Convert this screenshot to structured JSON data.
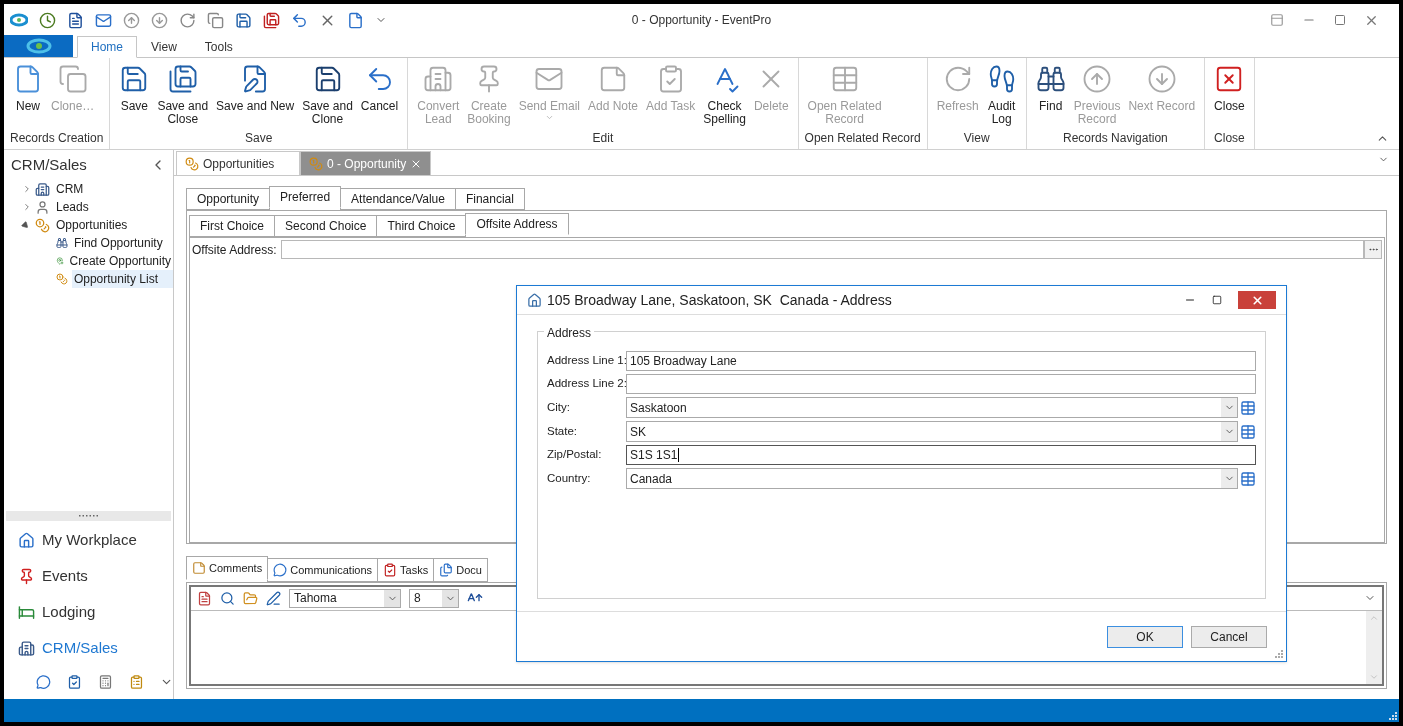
{
  "window": {
    "title": "0 - Opportunity - EventPro"
  },
  "ribbon": {
    "tabs": [
      {
        "label": "Home",
        "selected": true
      },
      {
        "label": "View",
        "selected": false
      },
      {
        "label": "Tools",
        "selected": false
      }
    ],
    "groups": [
      {
        "label": "Records Creation",
        "buttons": [
          {
            "label": "New",
            "disabled": false,
            "dropdown": false
          },
          {
            "label": "Clone…",
            "disabled": true,
            "dropdown": false
          }
        ]
      },
      {
        "label": "Save",
        "buttons": [
          {
            "label": "Save",
            "disabled": false,
            "dropdown": false
          },
          {
            "label": "Save and\nClose",
            "disabled": false,
            "dropdown": false
          },
          {
            "label": "Save and New",
            "disabled": false,
            "dropdown": false
          },
          {
            "label": "Save and\nClone",
            "disabled": false,
            "dropdown": false
          },
          {
            "label": "Cancel",
            "disabled": false,
            "dropdown": false
          }
        ]
      },
      {
        "label": "Edit",
        "buttons": [
          {
            "label": "Convert\nLead",
            "disabled": true,
            "dropdown": false
          },
          {
            "label": "Create\nBooking",
            "disabled": true,
            "dropdown": false
          },
          {
            "label": "Send Email",
            "disabled": true,
            "dropdown": true
          },
          {
            "label": "Add Note",
            "disabled": true,
            "dropdown": false
          },
          {
            "label": "Add Task",
            "disabled": true,
            "dropdown": false
          },
          {
            "label": "Check\nSpelling",
            "disabled": false,
            "dropdown": false
          },
          {
            "label": "Delete",
            "disabled": true,
            "dropdown": false
          }
        ]
      },
      {
        "label": "Open Related Record",
        "buttons": [
          {
            "label": "Open Related\nRecord",
            "disabled": true,
            "dropdown": false
          }
        ]
      },
      {
        "label": "View",
        "buttons": [
          {
            "label": "Refresh",
            "disabled": true,
            "dropdown": false
          },
          {
            "label": "Audit\nLog",
            "disabled": false,
            "dropdown": false
          }
        ]
      },
      {
        "label": "Records Navigation",
        "buttons": [
          {
            "label": "Find",
            "disabled": false,
            "dropdown": false
          },
          {
            "label": "Previous\nRecord",
            "disabled": true,
            "dropdown": false
          },
          {
            "label": "Next Record",
            "disabled": true,
            "dropdown": false
          }
        ]
      },
      {
        "label": "Close",
        "buttons": [
          {
            "label": "Close",
            "disabled": false,
            "dropdown": false
          }
        ]
      }
    ]
  },
  "sidebar": {
    "title": "CRM/Sales",
    "tree": [
      {
        "label": "CRM",
        "expanded": false,
        "selected": false
      },
      {
        "label": "Leads",
        "expanded": false,
        "selected": false
      },
      {
        "label": "Opportunities",
        "expanded": true,
        "selected": false,
        "children": [
          {
            "label": "Find Opportunity",
            "selected": false
          },
          {
            "label": "Create Opportunity",
            "selected": false
          },
          {
            "label": "Opportunity List",
            "selected": true
          }
        ]
      }
    ],
    "nav": [
      {
        "label": "My Workplace",
        "selected": false
      },
      {
        "label": "Events",
        "selected": false
      },
      {
        "label": "Lodging",
        "selected": false
      },
      {
        "label": "CRM/Sales",
        "selected": true
      }
    ]
  },
  "document_tabs": [
    {
      "label": "Opportunities",
      "selected": false
    },
    {
      "label": "0 - Opportunity",
      "selected": true
    }
  ],
  "form_tabs": [
    {
      "label": "Opportunity",
      "selected": false
    },
    {
      "label": "Preferred",
      "selected": true
    },
    {
      "label": "Attendance/Value",
      "selected": false
    },
    {
      "label": "Financial",
      "selected": false
    }
  ],
  "sub_tabs": [
    {
      "label": "First Choice",
      "selected": false
    },
    {
      "label": "Second Choice",
      "selected": false
    },
    {
      "label": "Third Choice",
      "selected": false
    },
    {
      "label": "Offsite Address",
      "selected": true
    }
  ],
  "offsite_field": {
    "label": "Offsite Address:"
  },
  "bottom_tabs": [
    {
      "label": "Comments",
      "selected": true
    },
    {
      "label": "Communications",
      "selected": false
    },
    {
      "label": "Tasks",
      "selected": false
    },
    {
      "label": "Docu",
      "selected": false
    }
  ],
  "editor": {
    "font": "Tahoma",
    "size": "8"
  },
  "dialog": {
    "title": "105 Broadway Lane, Saskatoon, SK  Canada - Address",
    "group": "Address",
    "fields": [
      {
        "label": "Address Line 1:",
        "kind": "text",
        "value": "105 Broadway Lane",
        "focused": false
      },
      {
        "label": "Address Line 2:",
        "kind": "text",
        "focused": false
      },
      {
        "label": "City:",
        "kind": "combo",
        "value": "Saskatoon",
        "focused": false
      },
      {
        "label": "State:",
        "kind": "combo",
        "value": "SK",
        "focused": false
      },
      {
        "label": "Zip/Postal:",
        "kind": "text",
        "value": "S1S 1S1",
        "focused": true
      },
      {
        "label": "Country:",
        "kind": "combo",
        "value": "Canada",
        "focused": false
      }
    ],
    "buttons": [
      {
        "label": "OK",
        "default": true
      },
      {
        "label": "Cancel",
        "default": false
      }
    ]
  }
}
